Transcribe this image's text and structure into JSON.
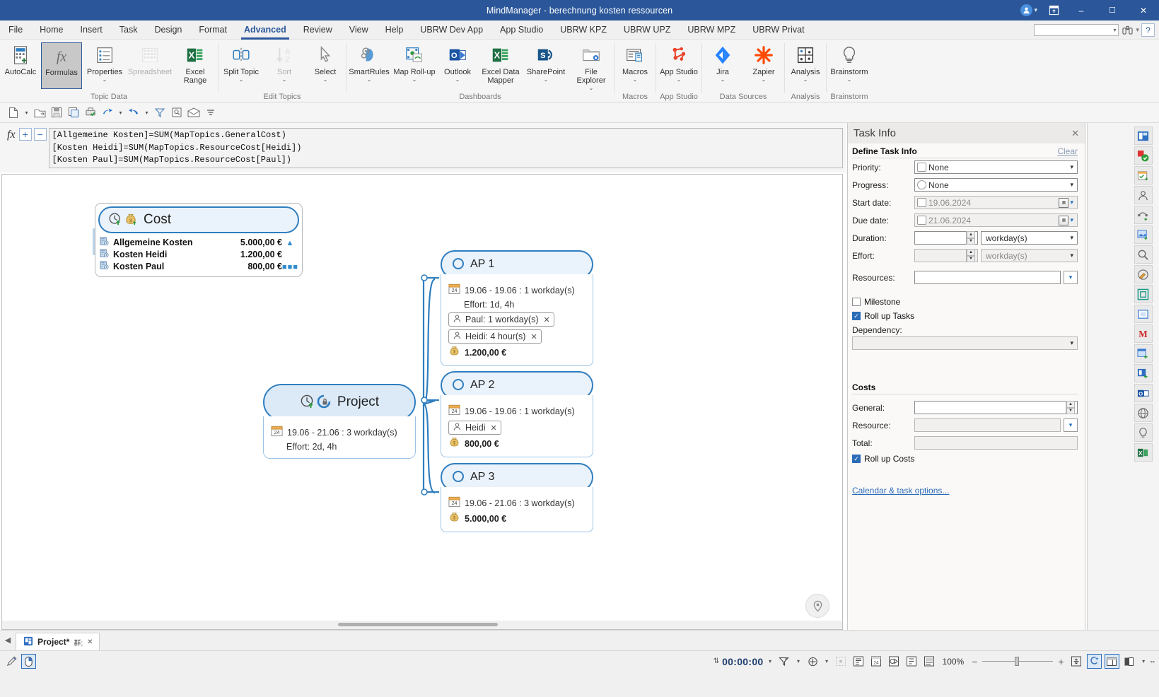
{
  "titlebar": {
    "title": "MindManager - berechnung kosten ressourcen",
    "account_icon": "user-icon",
    "ribbon_display_icon": "ribbon-display-options-icon",
    "minimize": "–",
    "maximize": "☐",
    "close": "✕"
  },
  "menubar": {
    "items": [
      {
        "label": "File",
        "active": false
      },
      {
        "label": "Home",
        "active": false
      },
      {
        "label": "Insert",
        "active": false
      },
      {
        "label": "Task",
        "active": false
      },
      {
        "label": "Design",
        "active": false
      },
      {
        "label": "Format",
        "active": false
      },
      {
        "label": "Advanced",
        "active": true
      },
      {
        "label": "Review",
        "active": false
      },
      {
        "label": "View",
        "active": false
      },
      {
        "label": "Help",
        "active": false
      },
      {
        "label": "UBRW Dev App",
        "active": false
      },
      {
        "label": "App Studio",
        "active": false
      },
      {
        "label": "UBRW KPZ",
        "active": false
      },
      {
        "label": "UBRW UPZ",
        "active": false
      },
      {
        "label": "UBRW MPZ",
        "active": false
      },
      {
        "label": "UBRW Privat",
        "active": false
      }
    ],
    "search_placeholder": "",
    "help_label": "?"
  },
  "ribbon": {
    "groups": [
      {
        "label": "Topic Data",
        "buttons": [
          {
            "label": "AutoCalc",
            "icon": "autocalc-icon",
            "dropdown": false,
            "disabled": false,
            "selected": false
          },
          {
            "label": "Formulas",
            "icon": "formulas-fx-icon",
            "dropdown": false,
            "disabled": false,
            "selected": true
          },
          {
            "label": "Properties",
            "icon": "properties-list-icon",
            "dropdown": true,
            "disabled": false,
            "selected": false
          },
          {
            "label": "Spreadsheet",
            "icon": "spreadsheet-grid-icon",
            "dropdown": false,
            "disabled": true,
            "selected": false
          },
          {
            "label": "Excel Range",
            "icon": "excel-icon",
            "dropdown": false,
            "disabled": false,
            "selected": false
          }
        ]
      },
      {
        "label": "Edit Topics",
        "buttons": [
          {
            "label": "Split Topic",
            "icon": "split-topic-icon",
            "dropdown": true,
            "disabled": false,
            "selected": false
          },
          {
            "label": "Sort",
            "icon": "sort-az-icon",
            "dropdown": true,
            "disabled": true,
            "selected": false
          },
          {
            "label": "Select",
            "icon": "cursor-arrow-icon",
            "dropdown": true,
            "disabled": false,
            "selected": false
          }
        ]
      },
      {
        "label": "Dashboards",
        "buttons": [
          {
            "label": "SmartRules",
            "icon": "smartrules-brain-icon",
            "dropdown": true,
            "disabled": false,
            "selected": false
          },
          {
            "label": "Map Roll-up",
            "icon": "map-rollup-icon",
            "dropdown": true,
            "disabled": false,
            "selected": false
          },
          {
            "label": "Outlook",
            "icon": "outlook-icon",
            "dropdown": true,
            "disabled": false,
            "selected": false
          },
          {
            "label": "Excel Data Mapper",
            "icon": "excel-icon",
            "dropdown": false,
            "disabled": false,
            "selected": false
          },
          {
            "label": "SharePoint",
            "icon": "sharepoint-icon",
            "dropdown": true,
            "disabled": false,
            "selected": false
          },
          {
            "label": "File Explorer",
            "icon": "file-explorer-icon",
            "dropdown": true,
            "disabled": false,
            "selected": false
          }
        ]
      },
      {
        "label": "Macros",
        "buttons": [
          {
            "label": "Macros",
            "icon": "macros-icon",
            "dropdown": true,
            "disabled": false,
            "selected": false
          }
        ]
      },
      {
        "label": "App Studio",
        "buttons": [
          {
            "label": "App Studio",
            "icon": "app-studio-icon",
            "dropdown": true,
            "disabled": false,
            "selected": false
          }
        ]
      },
      {
        "label": "Data Sources",
        "buttons": [
          {
            "label": "Jira",
            "icon": "jira-icon",
            "dropdown": true,
            "disabled": false,
            "selected": false
          },
          {
            "label": "Zapier",
            "icon": "zapier-icon",
            "dropdown": true,
            "disabled": false,
            "selected": false
          }
        ]
      },
      {
        "label": "Analysis",
        "buttons": [
          {
            "label": "Analysis",
            "icon": "analysis-matrix-icon",
            "dropdown": true,
            "disabled": false,
            "selected": false
          }
        ]
      },
      {
        "label": "Brainstorm",
        "buttons": [
          {
            "label": "Brainstorm",
            "icon": "brainstorm-bulb-icon",
            "dropdown": true,
            "disabled": false,
            "selected": false
          }
        ]
      }
    ]
  },
  "quick_access": {
    "buttons": [
      {
        "icon": "new-document-icon",
        "dropdown": true
      },
      {
        "icon": "open-folder-icon",
        "dropdown": false
      },
      {
        "icon": "save-icon",
        "dropdown": false
      },
      {
        "icon": "save-as-icon",
        "dropdown": false
      },
      {
        "icon": "print-preview-icon",
        "dropdown": false
      },
      {
        "icon": "undo-icon",
        "dropdown": true
      },
      {
        "icon": "redo-icon",
        "dropdown": true
      },
      {
        "icon": "filter-icon",
        "dropdown": false
      },
      {
        "icon": "find-icon",
        "dropdown": false
      },
      {
        "icon": "send-mail-icon",
        "dropdown": false
      },
      {
        "icon": "more-options-icon",
        "dropdown": false
      }
    ]
  },
  "formula_bar": {
    "fx_label": "fx",
    "add_label": "+",
    "remove_label": "−",
    "lines": [
      "[Allgemeine Kosten]=SUM(MapTopics.GeneralCost)",
      "[Kosten Heidi]=SUM(MapTopics.ResourceCost[Heidi])",
      "[Kosten Paul]=SUM(MapTopics.ResourceCost[Paul])"
    ]
  },
  "map": {
    "cost_topic": {
      "title": "Cost",
      "icons": [
        "rollup-clock-icon",
        "money-bag-icon"
      ],
      "rows": [
        {
          "label": "Allgemeine Kosten",
          "value": "5.000,00 €",
          "tail": "collapse-arrow-icon"
        },
        {
          "label": "Kosten Heidi",
          "value": "1.200,00 €",
          "tail": ""
        },
        {
          "label": "Kosten Paul",
          "value": "800,00 €",
          "tail": "more-dots-icon"
        }
      ]
    },
    "project_topic": {
      "title": "Project",
      "icons": [
        "rollup-clock-icon",
        "progress-lock-icon"
      ],
      "date_range": "19.06 - 21.06 : 3 workday(s)",
      "effort": "Effort: 2d, 4h"
    },
    "subtopics": [
      {
        "title": "AP 1",
        "date_range": "19.06 - 19.06 : 1 workday(s)",
        "effort": "Effort: 1d, 4h",
        "resources": [
          "Paul: 1 workday(s)",
          "Heidi: 4 hour(s)"
        ],
        "cost": "1.200,00 €"
      },
      {
        "title": "AP 2",
        "date_range": "19.06 - 19.06 : 1 workday(s)",
        "effort": "",
        "resources": [
          "Heidi"
        ],
        "cost": "800,00 €"
      },
      {
        "title": "AP 3",
        "date_range": "19.06 - 21.06 : 3 workday(s)",
        "effort": "",
        "resources": [],
        "cost": "5.000,00 €"
      }
    ],
    "location_pin_icon": "location-pin-icon"
  },
  "task_panel": {
    "title": "Task Info",
    "close_icon": "close-icon",
    "define_section": "Define Task Info",
    "clear_link": "Clear",
    "fields": {
      "priority_label": "Priority:",
      "priority_value": "None",
      "progress_label": "Progress:",
      "progress_value": "None",
      "start_label": "Start date:",
      "start_value": "19.06.2024",
      "due_label": "Due date:",
      "due_value": "21.06.2024",
      "duration_label": "Duration:",
      "duration_value": "",
      "duration_unit": "workday(s)",
      "effort_label": "Effort:",
      "effort_value": "",
      "effort_unit": "workday(s)",
      "resources_label": "Resources:",
      "resources_value": "",
      "milestone_label": "Milestone",
      "milestone_checked": false,
      "rollup_tasks_label": "Roll up Tasks",
      "rollup_tasks_checked": true,
      "dependency_label": "Dependency:",
      "dependency_value": ""
    },
    "costs_section": "Costs",
    "costs": {
      "general_label": "General:",
      "general_value": "",
      "resource_label": "Resource:",
      "resource_value": "",
      "total_label": "Total:",
      "total_value": "",
      "rollup_costs_label": "Roll up Costs",
      "rollup_costs_checked": true
    },
    "options_link": "Calendar & task options..."
  },
  "icon_strip": {
    "buttons": [
      {
        "icon": "map-parts-icon"
      },
      {
        "icon": "tasks-validate-icon"
      },
      {
        "icon": "calendar-add-icon"
      },
      {
        "icon": "resources-person-icon"
      },
      {
        "icon": "relationship-add-icon"
      },
      {
        "icon": "image-add-icon"
      },
      {
        "icon": "search-icon"
      },
      {
        "icon": "format-brush-icon"
      },
      {
        "icon": "fit-map-icon"
      },
      {
        "icon": "topic-notes-icon"
      },
      {
        "icon": "mindmanager-m-icon"
      },
      {
        "icon": "add-topic-panel-icon"
      },
      {
        "icon": "add-map-part-icon"
      },
      {
        "icon": "outlook-icon"
      },
      {
        "icon": "web-globe-icon"
      },
      {
        "icon": "idea-bulb-icon"
      },
      {
        "icon": "excel-icon"
      }
    ]
  },
  "tabbar": {
    "nav_icon": "tab-scroll-left-icon",
    "tabs": [
      {
        "label": "Project*",
        "icon": "map-document-icon",
        "restore_icon": "restore-icon",
        "close_icon": "close-icon"
      }
    ]
  },
  "statusbar": {
    "left_buttons": [
      {
        "icon": "pen-tool-icon",
        "selected": false
      },
      {
        "icon": "mouse-pointer-icon",
        "selected": true
      }
    ],
    "timer": "00:00:00",
    "timer_dropdown": "▾",
    "right_buttons": [
      {
        "icon": "filter-icon",
        "dropdown": true
      },
      {
        "icon": "focus-add-icon",
        "dropdown": true
      },
      {
        "icon": "fit-selection-icon",
        "dropdown": false
      },
      {
        "icon": "outline-view-icon",
        "dropdown": false
      },
      {
        "icon": "gantt-view-icon",
        "dropdown": false
      },
      {
        "icon": "tag-view-icon",
        "dropdown": false
      },
      {
        "icon": "index-view-icon",
        "dropdown": false
      },
      {
        "icon": "slides-view-icon",
        "dropdown": false
      }
    ],
    "zoom_level": "100%",
    "zoom_out": "−",
    "zoom_in": "+",
    "fit_icon": "fit-to-window-icon",
    "snap_icon": "snap-grid-icon",
    "layout_icon": "panel-layout-icon",
    "split_icon": "split-view-icon",
    "grip_icon": "resize-grip-icon"
  },
  "colors": {
    "title_bar": "#2b579a",
    "accent": "#2b6cb8",
    "node_border": "#2f7ec0",
    "node_fill": "#eaf2fb",
    "ribbon_bg": "#f5f5f5",
    "panel_bg": "#faf9f8"
  }
}
